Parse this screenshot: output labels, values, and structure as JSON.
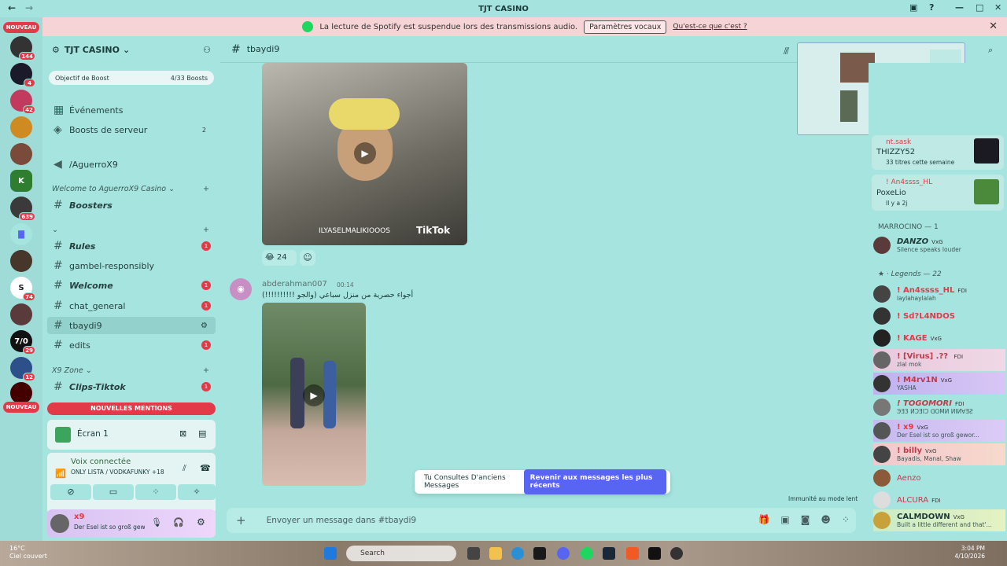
{
  "window": {
    "title": "TJT CASINO"
  },
  "banner": {
    "text": "La lecture de Spotify est suspendue lors des transmissions audio.",
    "button": "Paramètres vocaux",
    "link": "Qu'est-ce que c'est ?"
  },
  "rail": {
    "nouveau_top": "NOUVEAU",
    "nouveau_bottom": "NOUVEAU",
    "badges": [
      "144",
      "4",
      "42",
      "639",
      "74",
      "29",
      "12"
    ]
  },
  "server": {
    "name": "TJT CASINO",
    "boost_label": "Objectif de Boost",
    "boost_count": "4/33 Boosts",
    "events": "Événements",
    "boosts": "Boosts de serveur",
    "boosts_count": "2",
    "forum": "/AguerroX9"
  },
  "categories": {
    "welcome": "Welcome to AguerroX9 Casino",
    "x9zone": "X9 Zone"
  },
  "channels": [
    {
      "name": "Boosters",
      "badge": ""
    },
    {
      "name": "Rules",
      "badge": "1"
    },
    {
      "name": "gambel-responsibly",
      "badge": ""
    },
    {
      "name": "Welcome",
      "badge": "1"
    },
    {
      "name": "chat_general",
      "badge": "1"
    },
    {
      "name": "tbaydi9",
      "badge": ""
    },
    {
      "name": "edits",
      "badge": "1"
    },
    {
      "name": "Clips-Tiktok",
      "badge": "1"
    }
  ],
  "sidebar": {
    "new_mentions": "NOUVELLES MENTIONS",
    "screen": "Écran 1",
    "voice_title": "Voix connectée",
    "voice_sub": "ONLY LISTA / VODKAFUNKY +18",
    "user_name": "x9",
    "user_status": "Der Esel ist so groß gewo"
  },
  "chat": {
    "channel": "tbaydi9",
    "video1_watermark": "ILYASELMALIKIOOOS",
    "video1_brand": "TikTok",
    "reaction_count": "24",
    "message": {
      "author": "abderahman007",
      "time": "00:14",
      "text": "أجواء حصرية من منزل سباعي (والجو !!!!!!!!!!)"
    },
    "jump_text": "Tu Consultes D'anciens Messages",
    "jump_button": "Revenir aux messages les plus récents",
    "slowmode": "Immunité au mode lent",
    "composer_placeholder": "Envoyer un message dans #tbaydi9"
  },
  "activity": [
    {
      "name": "nt.sask",
      "title": "THIZZY52",
      "sub": "33 titres cette semaine"
    },
    {
      "name": "! An4ssss_HL",
      "title": "PoxeLio",
      "sub": "Il y a 2j"
    }
  ],
  "members": {
    "group1": "MARROCINO — 1",
    "group2": "Legends — 22",
    "list": [
      {
        "name": "DANZO",
        "tag": "VxG",
        "sub": "Silence speaks louder"
      },
      {
        "name": "! An4ssss_HL",
        "tag": "FDI",
        "sub": "laylahaylalah"
      },
      {
        "name": "! Sd?L4NDOS",
        "tag": "",
        "sub": ""
      },
      {
        "name": "! KAGE",
        "tag": "VxG",
        "sub": ""
      },
      {
        "name": "! [Virus] .?? ",
        "tag": "FDI",
        "sub": "zlal mok"
      },
      {
        "name": "! M4rv1N",
        "tag": "VxG",
        "sub": "YASHA"
      },
      {
        "name": "! TOGOMORI",
        "tag": "FDI",
        "sub": "ЭƎ3 ИƆƎIƆ ᗡOMИ ИIИ∀ƎꙄ"
      },
      {
        "name": "! x9",
        "tag": "VxG",
        "sub": "Der Esel ist so groß gewor..."
      },
      {
        "name": "! billy",
        "tag": "VxG",
        "sub": "Bayadis, Manal, Shaw"
      },
      {
        "name": "Aenzo",
        "tag": "",
        "sub": ""
      },
      {
        "name": "ALCURA",
        "tag": "FDI",
        "sub": ""
      },
      {
        "name": "CALMDOWN",
        "tag": "VxG",
        "sub": "Built a little different and that'..."
      }
    ]
  },
  "taskbar": {
    "temp": "16°C",
    "weather": "Ciel couvert",
    "search": "Search",
    "time": "3:04 PM",
    "date": "4/10/2026"
  }
}
